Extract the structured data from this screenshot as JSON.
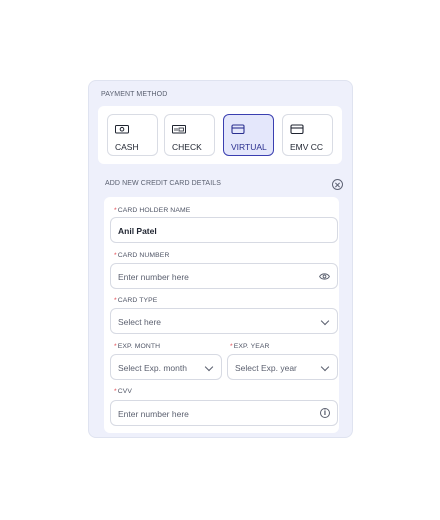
{
  "payment": {
    "section_label": "PAYMENT METHOD",
    "methods": [
      {
        "label": "CASH",
        "icon": "cash-icon"
      },
      {
        "label": "CHECK",
        "icon": "check-icon"
      },
      {
        "label": "VIRTUAL",
        "icon": "card-icon",
        "selected": true
      },
      {
        "label": "EMV CC",
        "icon": "card-icon"
      }
    ],
    "accent_color": "#3a3fb0"
  },
  "card_form": {
    "section_label": "ADD NEW CREDIT CARD DETAILS",
    "required_marker": "*",
    "holder_name": {
      "label": "CARD HOLDER NAME",
      "value": "Anil Patel"
    },
    "card_number": {
      "label": "CARD NUMBER",
      "placeholder": "Enter number here",
      "icon": "eye-icon"
    },
    "card_type": {
      "label": "CARD TYPE",
      "placeholder": "Select here"
    },
    "exp_month": {
      "label": "EXP. MONTH",
      "placeholder": "Select Exp. month"
    },
    "exp_year": {
      "label": "EXP. YEAR",
      "placeholder": "Select Exp. year"
    },
    "cvv": {
      "label": "CVV",
      "placeholder": "Enter number here",
      "icon": "info-icon",
      "icon_glyph": "i"
    }
  }
}
